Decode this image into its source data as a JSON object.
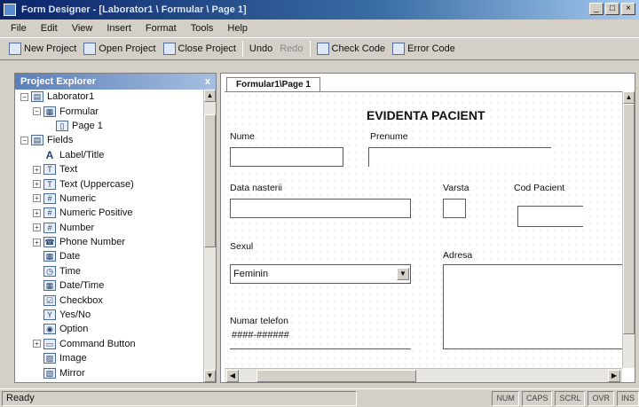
{
  "window": {
    "title": "Form Designer - [Laborator1 \\ Formular \\ Page 1]",
    "buttons": [
      "_",
      "□",
      "×"
    ]
  },
  "menu": [
    "File",
    "Edit",
    "View",
    "Insert",
    "Format",
    "Tools",
    "Help"
  ],
  "toolbar": {
    "new_project": "New Project",
    "open_project": "Open Project",
    "close_project": "Close Project",
    "undo": "Undo",
    "redo": "Redo",
    "check_code": "Check Code",
    "error_code": "Error Code"
  },
  "explorer": {
    "title": "Project Explorer",
    "close": "x",
    "items": [
      {
        "label": "Laborator1",
        "expander": "−",
        "icon": "project-icon",
        "glyph": "▤",
        "indent": 0
      },
      {
        "label": "Formular",
        "expander": "−",
        "icon": "form-icon",
        "glyph": "▦",
        "indent": 1
      },
      {
        "label": "Page 1",
        "expander": "",
        "icon": "page-icon",
        "glyph": "▯",
        "indent": 2
      },
      {
        "label": "Fields",
        "expander": "−",
        "icon": "fields-icon",
        "glyph": "▤",
        "indent": 0
      },
      {
        "label": "Label/Title",
        "expander": "",
        "icon": "label-icon",
        "glyph": "A",
        "indent": 1
      },
      {
        "label": "Text",
        "expander": "+",
        "icon": "text-icon",
        "glyph": "T",
        "indent": 1
      },
      {
        "label": "Text (Uppercase)",
        "expander": "+",
        "icon": "text-upper-icon",
        "glyph": "T",
        "indent": 1
      },
      {
        "label": "Numeric",
        "expander": "+",
        "icon": "numeric-icon",
        "glyph": "#",
        "indent": 1
      },
      {
        "label": "Numeric Positive",
        "expander": "+",
        "icon": "numeric-positive-icon",
        "glyph": "#",
        "indent": 1
      },
      {
        "label": "Number",
        "expander": "+",
        "icon": "number-icon",
        "glyph": "#",
        "indent": 1
      },
      {
        "label": "Phone Number",
        "expander": "+",
        "icon": "phone-icon",
        "glyph": "☎",
        "indent": 1
      },
      {
        "label": "Date",
        "expander": "",
        "icon": "date-icon",
        "glyph": "▦",
        "indent": 1
      },
      {
        "label": "Time",
        "expander": "",
        "icon": "time-icon",
        "glyph": "◷",
        "indent": 1
      },
      {
        "label": "Date/Time",
        "expander": "",
        "icon": "datetime-icon",
        "glyph": "▦",
        "indent": 1
      },
      {
        "label": "Checkbox",
        "expander": "",
        "icon": "checkbox-icon",
        "glyph": "☑",
        "indent": 1
      },
      {
        "label": "Yes/No",
        "expander": "",
        "icon": "yesno-icon",
        "glyph": "Y",
        "indent": 1
      },
      {
        "label": "Option",
        "expander": "",
        "icon": "option-icon",
        "glyph": "◉",
        "indent": 1
      },
      {
        "label": "Command Button",
        "expander": "+",
        "icon": "command-button-icon",
        "glyph": "▭",
        "indent": 1
      },
      {
        "label": "Image",
        "expander": "",
        "icon": "image-icon",
        "glyph": "▨",
        "indent": 1
      },
      {
        "label": "Mirror",
        "expander": "",
        "icon": "mirror-icon",
        "glyph": "▧",
        "indent": 1
      }
    ]
  },
  "designer": {
    "tab": "Formular1\\Page 1",
    "form_title": "EVIDENTA PACIENT",
    "labels": {
      "nume": "Nume",
      "prenume": "Prenume",
      "data_nasterii": "Data nasterii",
      "varsta": "Varsta",
      "cod_pacient": "Cod Pacient",
      "sexul": "Sexul",
      "adresa": "Adresa",
      "numar_telefon": "Numar telefon"
    },
    "fields": {
      "sexul_value": "Feminin",
      "telefon_value": "####-######"
    }
  },
  "status": {
    "main": "Ready",
    "cells": [
      "NUM",
      "CAPS",
      "SCRL",
      "OVR",
      "INS"
    ]
  }
}
